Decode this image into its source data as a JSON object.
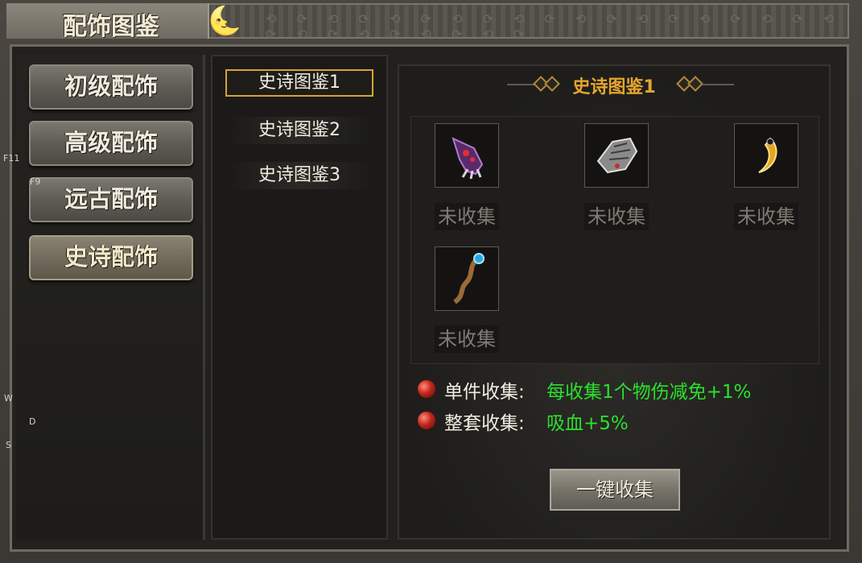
{
  "window": {
    "title": "配饰图鉴"
  },
  "categories": [
    {
      "label": "初级配饰",
      "active": false
    },
    {
      "label": "高级配饰",
      "active": false
    },
    {
      "label": "远古配饰",
      "active": false
    },
    {
      "label": "史诗配饰",
      "active": true
    }
  ],
  "codex_tabs": [
    {
      "label": "史诗图鉴1",
      "selected": true
    },
    {
      "label": "史诗图鉴2",
      "selected": false
    },
    {
      "label": "史诗图鉴3",
      "selected": false
    }
  ],
  "panel": {
    "title": "史诗图鉴1",
    "items": [
      {
        "icon": "purple-claw-gauntlet-icon",
        "status": "未收集"
      },
      {
        "icon": "silver-bone-gauntlet-icon",
        "status": "未收集"
      },
      {
        "icon": "golden-fang-icon",
        "status": "未收集"
      },
      {
        "icon": "serpent-staff-icon",
        "status": "未收集"
      }
    ],
    "bonuses": [
      {
        "label": "单件收集:",
        "value": "每收集1个物伤减免+1%"
      },
      {
        "label": "整套收集:",
        "value": "吸血+5%"
      }
    ],
    "collect_button": "一键收集"
  },
  "hotkeys": {
    "f11": "F11",
    "f9": "F9",
    "w": "W",
    "d": "D",
    "s": "S"
  },
  "colors": {
    "accent_gold": "#e5a62d",
    "bonus_green": "#2be02b",
    "status_gray": "#7e7b74"
  }
}
